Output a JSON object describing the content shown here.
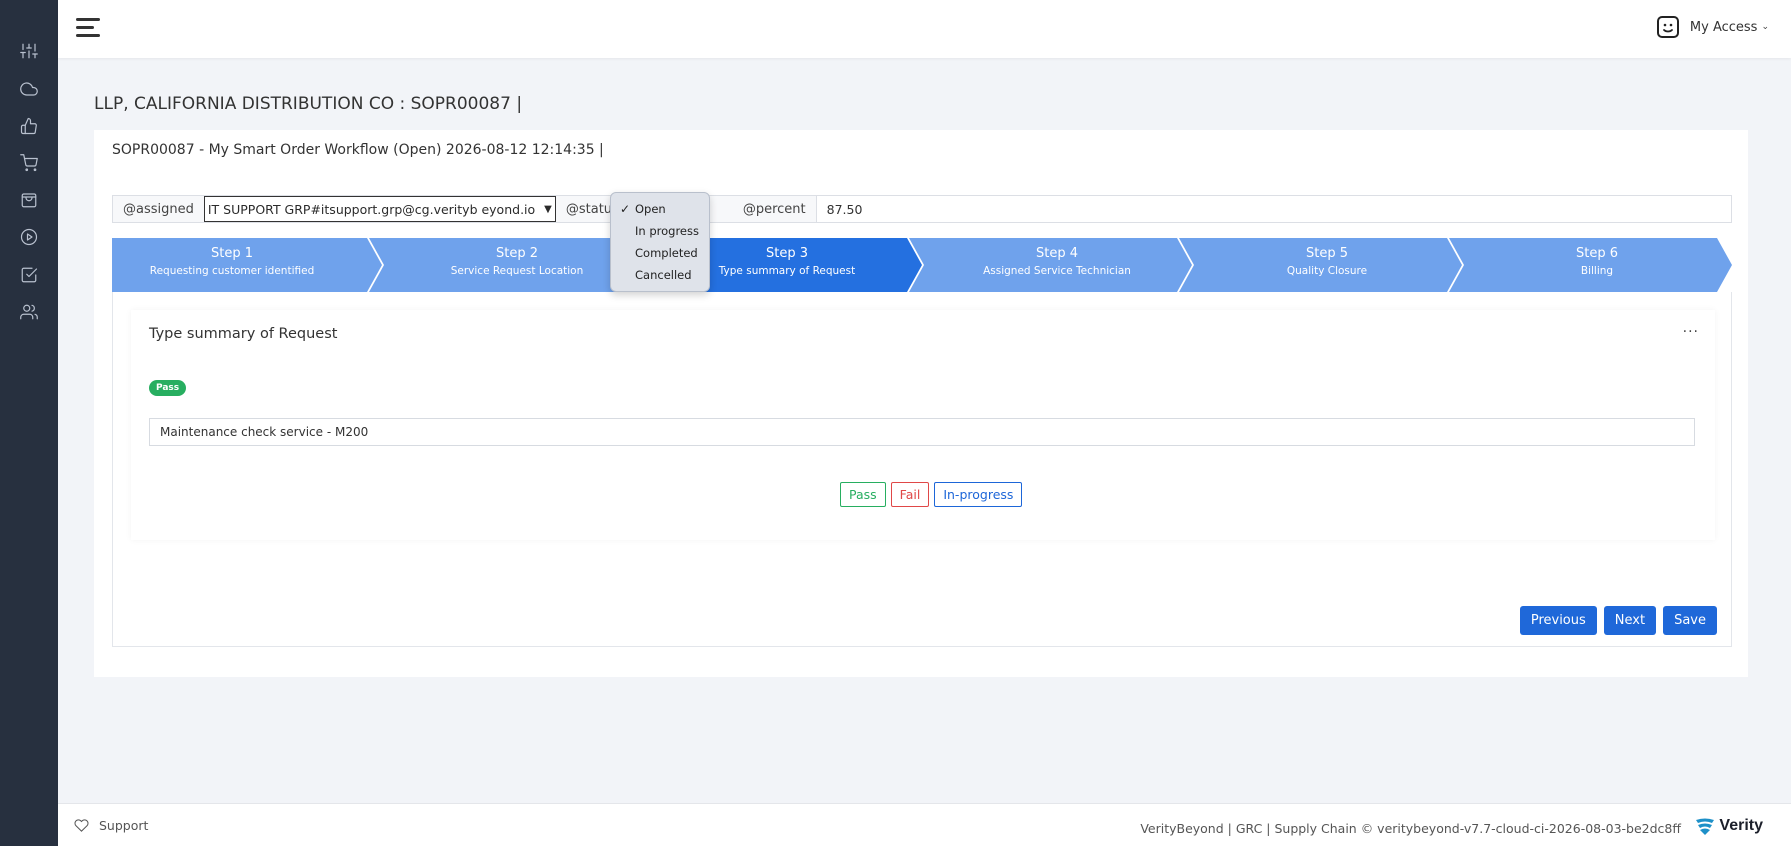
{
  "colors": {
    "rail": "#27303f",
    "accent": "#1f68d9",
    "step_active": "#2470e0",
    "step_inactive": "#6fa2ec",
    "pass": "#27ae60",
    "fail": "#e04848"
  },
  "rail": {
    "icons": [
      "sliders-icon",
      "cloud-icon",
      "thumbs-up-icon",
      "cart-icon",
      "shopping-bag-icon",
      "play-circle-icon",
      "check-square-icon",
      "users-icon"
    ]
  },
  "header": {
    "access_label": "My Access"
  },
  "page": {
    "title": "LLP, CALIFORNIA DISTRIBUTION CO : SOPR00087 |",
    "subtitle": "SOPR00087 - My Smart Order Workflow (Open) 2026-08-12 12:14:35 |"
  },
  "fields": {
    "assigned_label": "@assigned",
    "assigned_value": "IT SUPPORT GRP#itsupport.grp@cg.verityb eyond.io",
    "status_label": "@status",
    "percent_label": "@percent",
    "percent_value": "87.50"
  },
  "status_dropdown": {
    "selected": "Open",
    "options": [
      "Open",
      "In progress",
      "Completed",
      "Cancelled"
    ]
  },
  "steps": [
    {
      "num": "Step 1",
      "label": "Requesting customer identified"
    },
    {
      "num": "Step 2",
      "label": "Service Request Location"
    },
    {
      "num": "Step 3",
      "label": "Type summary of Request"
    },
    {
      "num": "Step 4",
      "label": "Assigned Service Technician"
    },
    {
      "num": "Step 5",
      "label": "Quality Closure"
    },
    {
      "num": "Step 6",
      "label": "Billing"
    }
  ],
  "active_step": 3,
  "panel": {
    "title": "Type summary of Request",
    "more": "···",
    "badge": "Pass",
    "summary_value": "Maintenance check service - M200",
    "buttons": {
      "pass": "Pass",
      "fail": "Fail",
      "in_progress": "In-progress"
    }
  },
  "nav": {
    "previous": "Previous",
    "next": "Next",
    "save": "Save"
  },
  "footer": {
    "support": "Support",
    "text": "VerityBeyond | GRC | Supply Chain © veritybeyond-v7.7-cloud-ci-2026-08-03-be2dc8ff",
    "brand": "Verity"
  }
}
